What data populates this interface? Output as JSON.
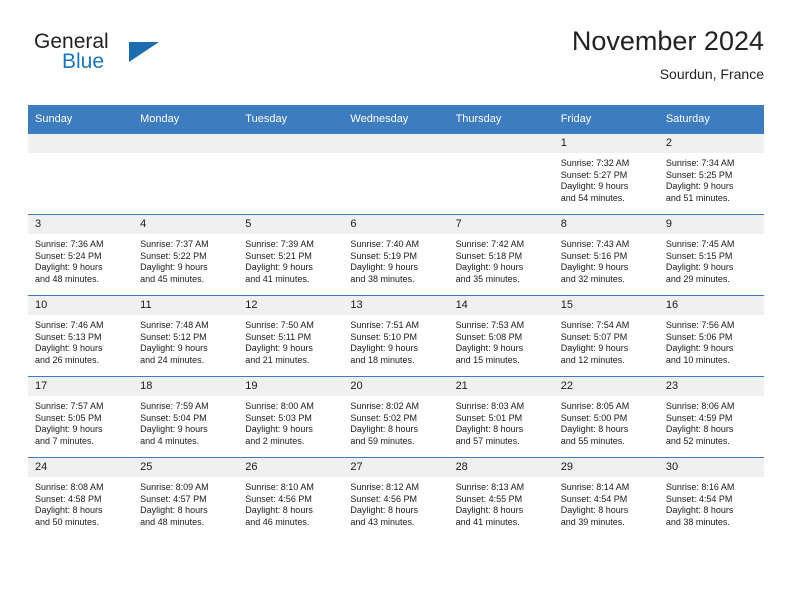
{
  "brand": {
    "word1": "General",
    "word2": "Blue",
    "triangle_color": "#1b6cb0",
    "blue_color": "#1b75bb"
  },
  "header": {
    "title": "November 2024",
    "subtitle": "Sourdun, France"
  },
  "theme": {
    "header_bg": "#3c7cbf",
    "daynum_bg": "#f0f0f0",
    "text": "#1a1a1a"
  },
  "weekday_headers": [
    "Sunday",
    "Monday",
    "Tuesday",
    "Wednesday",
    "Thursday",
    "Friday",
    "Saturday"
  ],
  "weeks": [
    [
      {
        "day": "",
        "sunrise": "",
        "sunset": "",
        "daylight1": "",
        "daylight2": ""
      },
      {
        "day": "",
        "sunrise": "",
        "sunset": "",
        "daylight1": "",
        "daylight2": ""
      },
      {
        "day": "",
        "sunrise": "",
        "sunset": "",
        "daylight1": "",
        "daylight2": ""
      },
      {
        "day": "",
        "sunrise": "",
        "sunset": "",
        "daylight1": "",
        "daylight2": ""
      },
      {
        "day": "",
        "sunrise": "",
        "sunset": "",
        "daylight1": "",
        "daylight2": ""
      },
      {
        "day": "1",
        "sunrise": "Sunrise: 7:32 AM",
        "sunset": "Sunset: 5:27 PM",
        "daylight1": "Daylight: 9 hours",
        "daylight2": "and 54 minutes."
      },
      {
        "day": "2",
        "sunrise": "Sunrise: 7:34 AM",
        "sunset": "Sunset: 5:25 PM",
        "daylight1": "Daylight: 9 hours",
        "daylight2": "and 51 minutes."
      }
    ],
    [
      {
        "day": "3",
        "sunrise": "Sunrise: 7:36 AM",
        "sunset": "Sunset: 5:24 PM",
        "daylight1": "Daylight: 9 hours",
        "daylight2": "and 48 minutes."
      },
      {
        "day": "4",
        "sunrise": "Sunrise: 7:37 AM",
        "sunset": "Sunset: 5:22 PM",
        "daylight1": "Daylight: 9 hours",
        "daylight2": "and 45 minutes."
      },
      {
        "day": "5",
        "sunrise": "Sunrise: 7:39 AM",
        "sunset": "Sunset: 5:21 PM",
        "daylight1": "Daylight: 9 hours",
        "daylight2": "and 41 minutes."
      },
      {
        "day": "6",
        "sunrise": "Sunrise: 7:40 AM",
        "sunset": "Sunset: 5:19 PM",
        "daylight1": "Daylight: 9 hours",
        "daylight2": "and 38 minutes."
      },
      {
        "day": "7",
        "sunrise": "Sunrise: 7:42 AM",
        "sunset": "Sunset: 5:18 PM",
        "daylight1": "Daylight: 9 hours",
        "daylight2": "and 35 minutes."
      },
      {
        "day": "8",
        "sunrise": "Sunrise: 7:43 AM",
        "sunset": "Sunset: 5:16 PM",
        "daylight1": "Daylight: 9 hours",
        "daylight2": "and 32 minutes."
      },
      {
        "day": "9",
        "sunrise": "Sunrise: 7:45 AM",
        "sunset": "Sunset: 5:15 PM",
        "daylight1": "Daylight: 9 hours",
        "daylight2": "and 29 minutes."
      }
    ],
    [
      {
        "day": "10",
        "sunrise": "Sunrise: 7:46 AM",
        "sunset": "Sunset: 5:13 PM",
        "daylight1": "Daylight: 9 hours",
        "daylight2": "and 26 minutes."
      },
      {
        "day": "11",
        "sunrise": "Sunrise: 7:48 AM",
        "sunset": "Sunset: 5:12 PM",
        "daylight1": "Daylight: 9 hours",
        "daylight2": "and 24 minutes."
      },
      {
        "day": "12",
        "sunrise": "Sunrise: 7:50 AM",
        "sunset": "Sunset: 5:11 PM",
        "daylight1": "Daylight: 9 hours",
        "daylight2": "and 21 minutes."
      },
      {
        "day": "13",
        "sunrise": "Sunrise: 7:51 AM",
        "sunset": "Sunset: 5:10 PM",
        "daylight1": "Daylight: 9 hours",
        "daylight2": "and 18 minutes."
      },
      {
        "day": "14",
        "sunrise": "Sunrise: 7:53 AM",
        "sunset": "Sunset: 5:08 PM",
        "daylight1": "Daylight: 9 hours",
        "daylight2": "and 15 minutes."
      },
      {
        "day": "15",
        "sunrise": "Sunrise: 7:54 AM",
        "sunset": "Sunset: 5:07 PM",
        "daylight1": "Daylight: 9 hours",
        "daylight2": "and 12 minutes."
      },
      {
        "day": "16",
        "sunrise": "Sunrise: 7:56 AM",
        "sunset": "Sunset: 5:06 PM",
        "daylight1": "Daylight: 9 hours",
        "daylight2": "and 10 minutes."
      }
    ],
    [
      {
        "day": "17",
        "sunrise": "Sunrise: 7:57 AM",
        "sunset": "Sunset: 5:05 PM",
        "daylight1": "Daylight: 9 hours",
        "daylight2": "and 7 minutes."
      },
      {
        "day": "18",
        "sunrise": "Sunrise: 7:59 AM",
        "sunset": "Sunset: 5:04 PM",
        "daylight1": "Daylight: 9 hours",
        "daylight2": "and 4 minutes."
      },
      {
        "day": "19",
        "sunrise": "Sunrise: 8:00 AM",
        "sunset": "Sunset: 5:03 PM",
        "daylight1": "Daylight: 9 hours",
        "daylight2": "and 2 minutes."
      },
      {
        "day": "20",
        "sunrise": "Sunrise: 8:02 AM",
        "sunset": "Sunset: 5:02 PM",
        "daylight1": "Daylight: 8 hours",
        "daylight2": "and 59 minutes."
      },
      {
        "day": "21",
        "sunrise": "Sunrise: 8:03 AM",
        "sunset": "Sunset: 5:01 PM",
        "daylight1": "Daylight: 8 hours",
        "daylight2": "and 57 minutes."
      },
      {
        "day": "22",
        "sunrise": "Sunrise: 8:05 AM",
        "sunset": "Sunset: 5:00 PM",
        "daylight1": "Daylight: 8 hours",
        "daylight2": "and 55 minutes."
      },
      {
        "day": "23",
        "sunrise": "Sunrise: 8:06 AM",
        "sunset": "Sunset: 4:59 PM",
        "daylight1": "Daylight: 8 hours",
        "daylight2": "and 52 minutes."
      }
    ],
    [
      {
        "day": "24",
        "sunrise": "Sunrise: 8:08 AM",
        "sunset": "Sunset: 4:58 PM",
        "daylight1": "Daylight: 8 hours",
        "daylight2": "and 50 minutes."
      },
      {
        "day": "25",
        "sunrise": "Sunrise: 8:09 AM",
        "sunset": "Sunset: 4:57 PM",
        "daylight1": "Daylight: 8 hours",
        "daylight2": "and 48 minutes."
      },
      {
        "day": "26",
        "sunrise": "Sunrise: 8:10 AM",
        "sunset": "Sunset: 4:56 PM",
        "daylight1": "Daylight: 8 hours",
        "daylight2": "and 46 minutes."
      },
      {
        "day": "27",
        "sunrise": "Sunrise: 8:12 AM",
        "sunset": "Sunset: 4:56 PM",
        "daylight1": "Daylight: 8 hours",
        "daylight2": "and 43 minutes."
      },
      {
        "day": "28",
        "sunrise": "Sunrise: 8:13 AM",
        "sunset": "Sunset: 4:55 PM",
        "daylight1": "Daylight: 8 hours",
        "daylight2": "and 41 minutes."
      },
      {
        "day": "29",
        "sunrise": "Sunrise: 8:14 AM",
        "sunset": "Sunset: 4:54 PM",
        "daylight1": "Daylight: 8 hours",
        "daylight2": "and 39 minutes."
      },
      {
        "day": "30",
        "sunrise": "Sunrise: 8:16 AM",
        "sunset": "Sunset: 4:54 PM",
        "daylight1": "Daylight: 8 hours",
        "daylight2": "and 38 minutes."
      }
    ]
  ]
}
